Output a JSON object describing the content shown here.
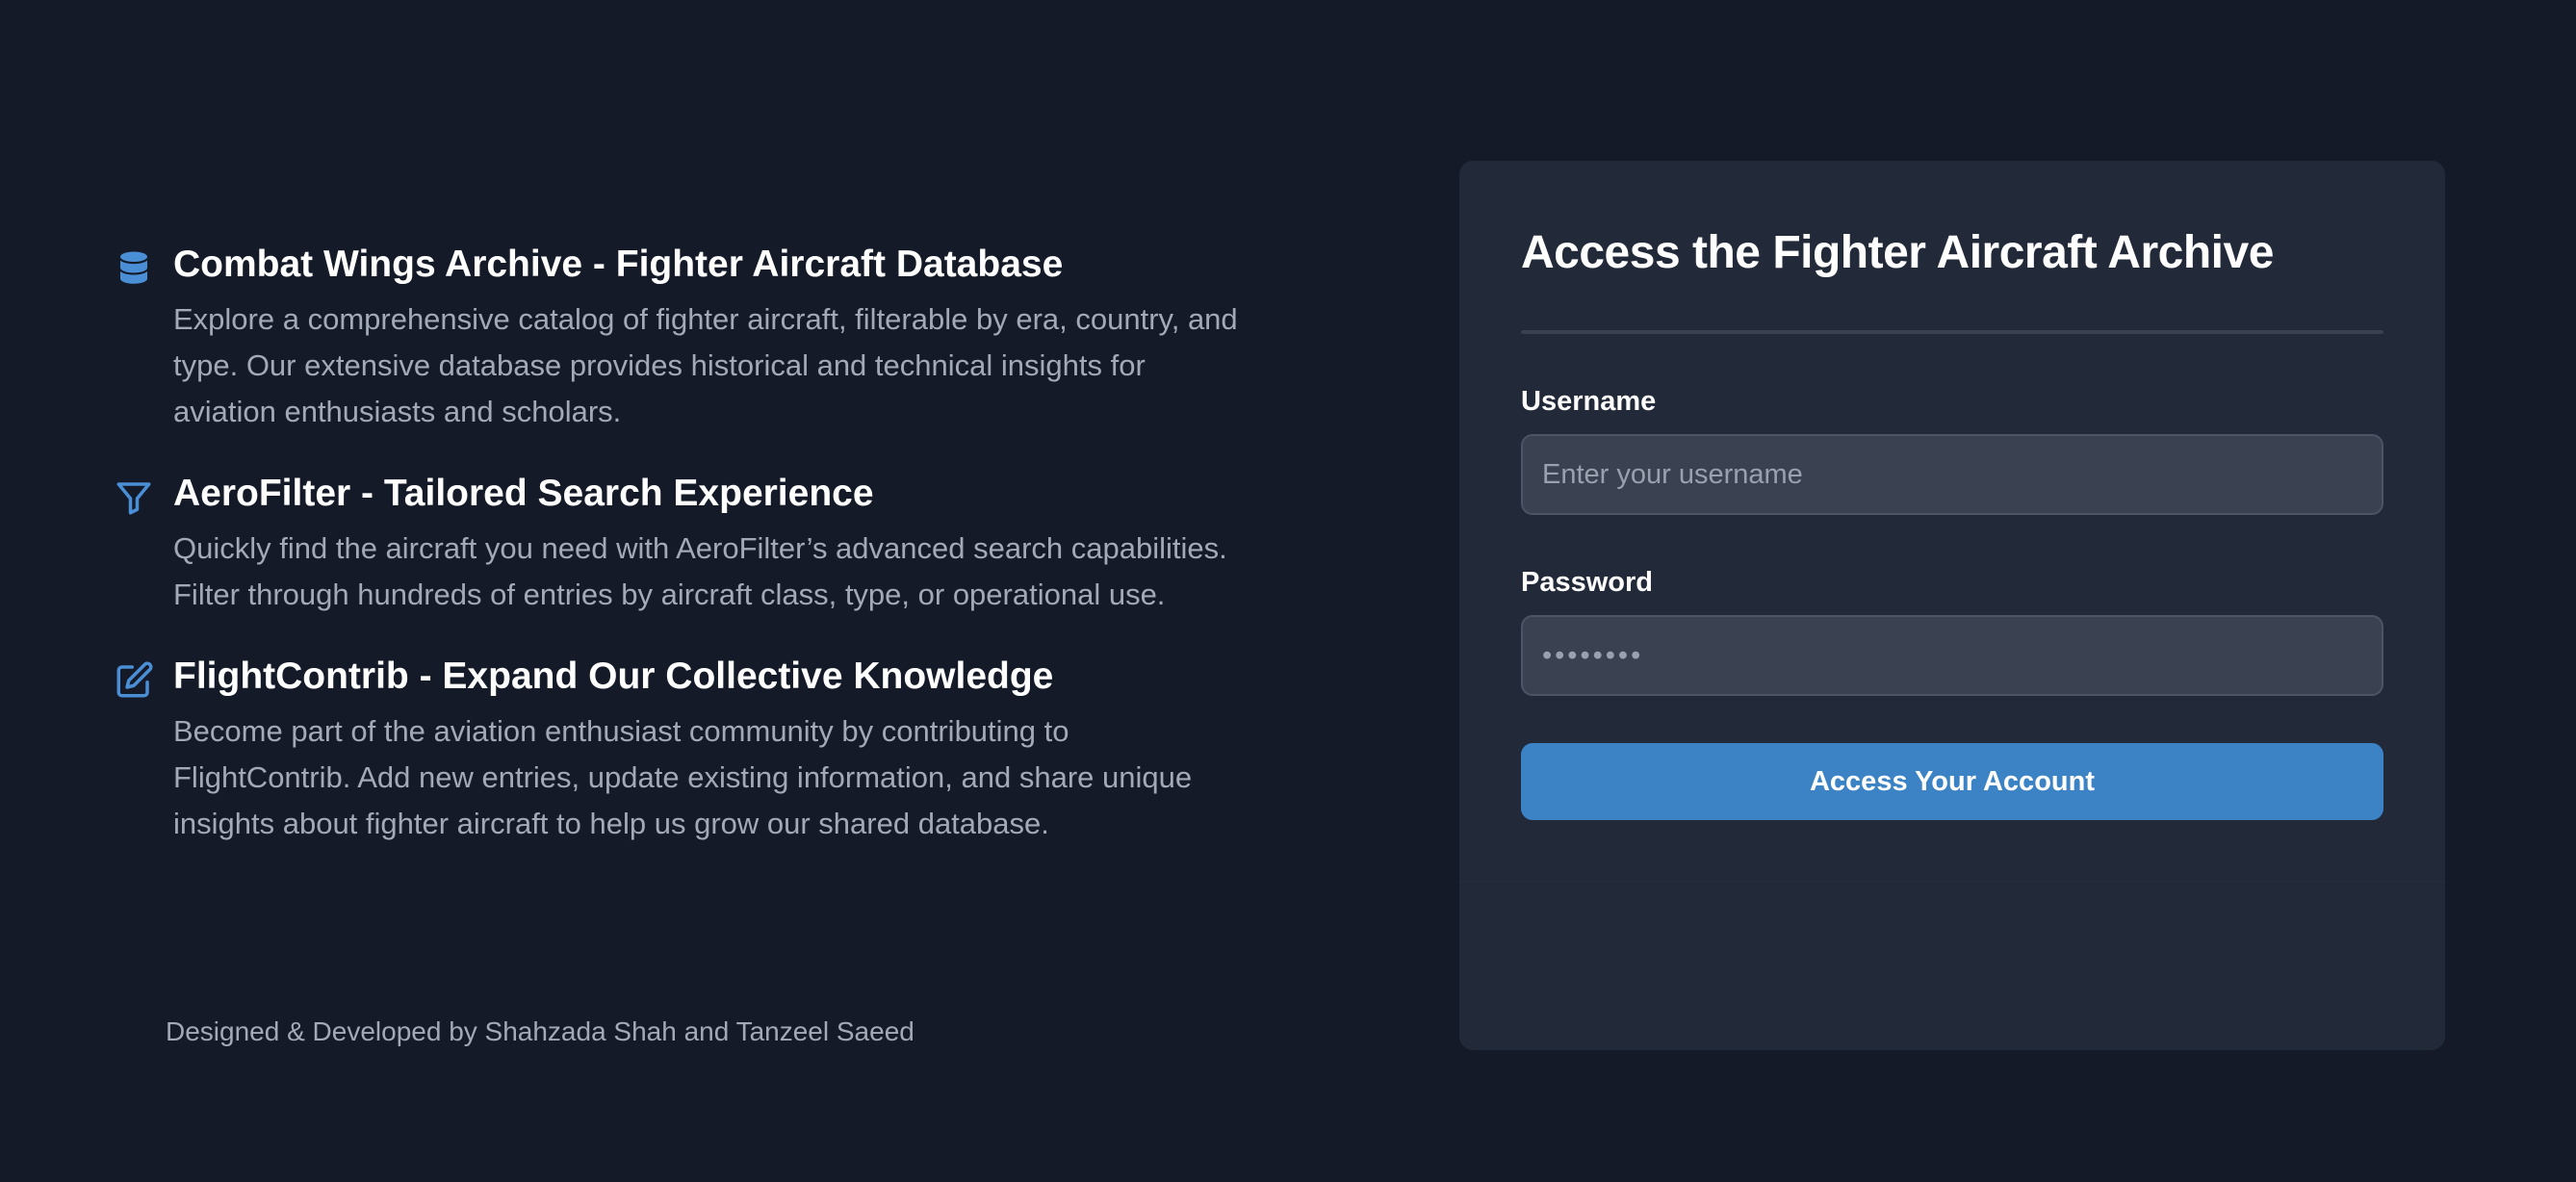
{
  "features": [
    {
      "icon": "database-icon",
      "title": "Combat Wings Archive - Fighter Aircraft Database",
      "description": "Explore a comprehensive catalog of fighter aircraft, filterable by era, country, and type. Our extensive database provides historical and technical insights for aviation enthusiasts and scholars."
    },
    {
      "icon": "filter-icon",
      "title": "AeroFilter - Tailored Search Experience",
      "description": "Quickly find the aircraft you need with AeroFilter’s advanced search capabilities. Filter through hundreds of entries by aircraft class, type, or operational use."
    },
    {
      "icon": "edit-icon",
      "title": "FlightContrib - Expand Our Collective Knowledge",
      "description": "Become part of the aviation enthusiast community by contributing to FlightContrib. Add new entries, update existing information, and share unique insights about fighter aircraft to help us grow our shared database."
    }
  ],
  "credit": "Designed & Developed by Shahzada Shah and Tanzeel Saeed",
  "login": {
    "title": "Access the Fighter Aircraft Archive",
    "username_label": "Username",
    "username_placeholder": "Enter your username",
    "username_value": "",
    "password_label": "Password",
    "password_value": "••••••••",
    "submit_label": "Access Your Account"
  },
  "colors": {
    "background": "#141a27",
    "card": "#222938",
    "accent": "#3b83c5",
    "icon": "#4a8fd6"
  }
}
